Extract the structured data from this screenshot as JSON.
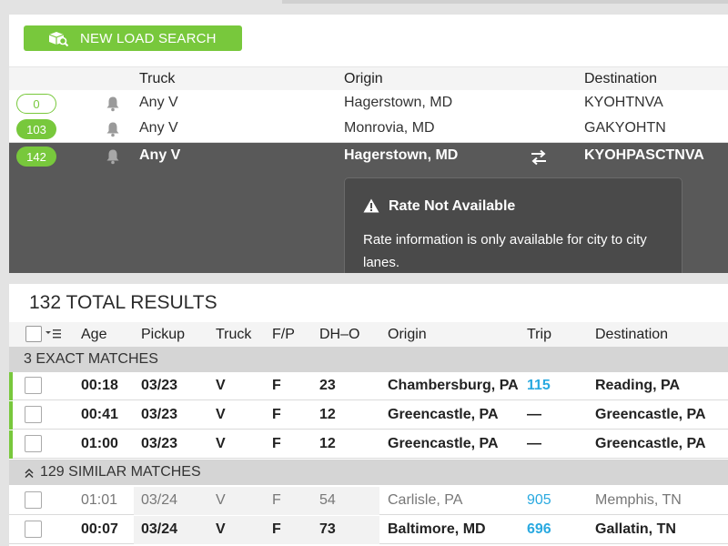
{
  "search_panel": {
    "new_search_label": "NEW LOAD SEARCH",
    "columns": {
      "truck": "Truck",
      "origin": "Origin",
      "destination": "Destination"
    },
    "rows": [
      {
        "count": "0",
        "truck": "Any V",
        "origin": "Hagerstown, MD",
        "destination": "KYOHTNVA"
      },
      {
        "count": "103",
        "truck": "Any V",
        "origin": "Monrovia, MD",
        "destination": "GAKYOHTN"
      },
      {
        "count": "142",
        "truck": "Any V",
        "origin": "Hagerstown, MD",
        "destination": "KYOHPASCTNVA"
      }
    ],
    "rate_box": {
      "title": "Rate Not Available",
      "text": "Rate information is only available for city to city lanes."
    }
  },
  "results": {
    "title": "132 TOTAL RESULTS",
    "columns": {
      "age": "Age",
      "pickup": "Pickup",
      "truck": "Truck",
      "fp": "F/P",
      "dho": "DH–O",
      "origin": "Origin",
      "trip": "Trip",
      "destination": "Destination"
    },
    "exact_label": "3 EXACT MATCHES",
    "similar_label": "129 SIMILAR MATCHES",
    "exact_rows": [
      {
        "age": "00:18",
        "pickup": "03/23",
        "truck": "V",
        "fp": "F",
        "dho": "23",
        "origin": "Chambersburg, PA",
        "trip": "115",
        "destination": "Reading, PA"
      },
      {
        "age": "00:41",
        "pickup": "03/23",
        "truck": "V",
        "fp": "F",
        "dho": "12",
        "origin": "Greencastle, PA",
        "trip": "—",
        "destination": "Greencastle, PA"
      },
      {
        "age": "01:00",
        "pickup": "03/23",
        "truck": "V",
        "fp": "F",
        "dho": "12",
        "origin": "Greencastle, PA",
        "trip": "—",
        "destination": "Greencastle, PA"
      }
    ],
    "similar_rows": [
      {
        "age": "01:01",
        "pickup": "03/24",
        "truck": "V",
        "fp": "F",
        "dho": "54",
        "origin": "Carlisle, PA",
        "trip": "905",
        "destination": "Memphis, TN"
      },
      {
        "age": "00:07",
        "pickup": "03/24",
        "truck": "V",
        "fp": "F",
        "dho": "73",
        "origin": "Baltimore, MD",
        "trip": "696",
        "destination": "Gallatin, TN"
      }
    ]
  },
  "colors": {
    "accent": "#78c83c",
    "link": "#29a9e0",
    "active_row": "#595959"
  },
  "icons": {
    "search_button": "truck-search-icon",
    "alert": "bell-icon",
    "swap": "swap-arrows-icon",
    "warning": "warning-icon",
    "sort": "sort-menu-icon",
    "collapse": "double-chevron-up-icon"
  }
}
